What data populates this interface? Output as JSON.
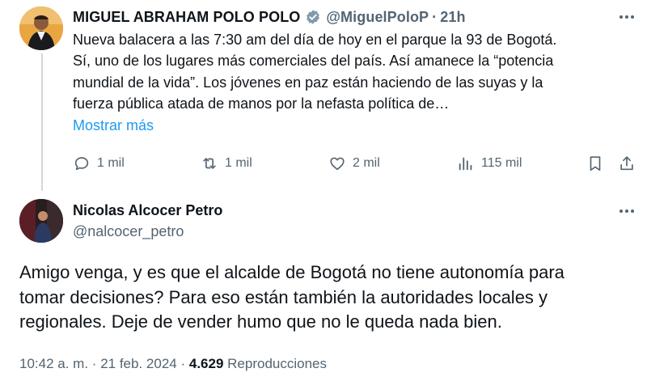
{
  "tweet": {
    "author_name": "MIGUEL ABRAHAM POLO POLO",
    "author_handle": "@MiguelPoloP",
    "separator": "·",
    "time": "21h",
    "text": "Nueva balacera a las 7:30 am del día de hoy en el parque la 93 de Bogotá.\nSí, uno de los lugares más comerciales del país. Así amanece la “potencia\nmundial de la vida”. Los jóvenes en paz están haciendo de las suyas y la\nfuerza pública atada de manos por la nefasta política de…",
    "show_more": "Mostrar más",
    "replies": "1 mil",
    "reposts": "1 mil",
    "likes": "2 mil",
    "views": "115 mil",
    "verified_color": "#829aab"
  },
  "reply": {
    "author_name": "Nicolas Alcocer Petro",
    "author_handle": "@nalcocer_petro",
    "text": "Amigo venga, y es que el alcalde de Bogotá no tiene autonomía para\ntomar decisiones? Para eso están también la autoridades locales y\nregionales. Deje de vender humo que no le queda nada bien.",
    "time": "10:42 a. m.",
    "separator1": "·",
    "date": "21 feb. 2024",
    "separator2": "·",
    "views_count": "4.629",
    "views_label": "Reproducciones"
  },
  "icons": [
    "verified-badge-icon",
    "more-icon",
    "reply-icon",
    "repost-icon",
    "like-icon",
    "views-icon",
    "bookmark-icon",
    "share-icon"
  ],
  "colors": {
    "link": "#1d9bf0",
    "secondary_text": "#536471",
    "thread_line": "#cfd9de"
  }
}
